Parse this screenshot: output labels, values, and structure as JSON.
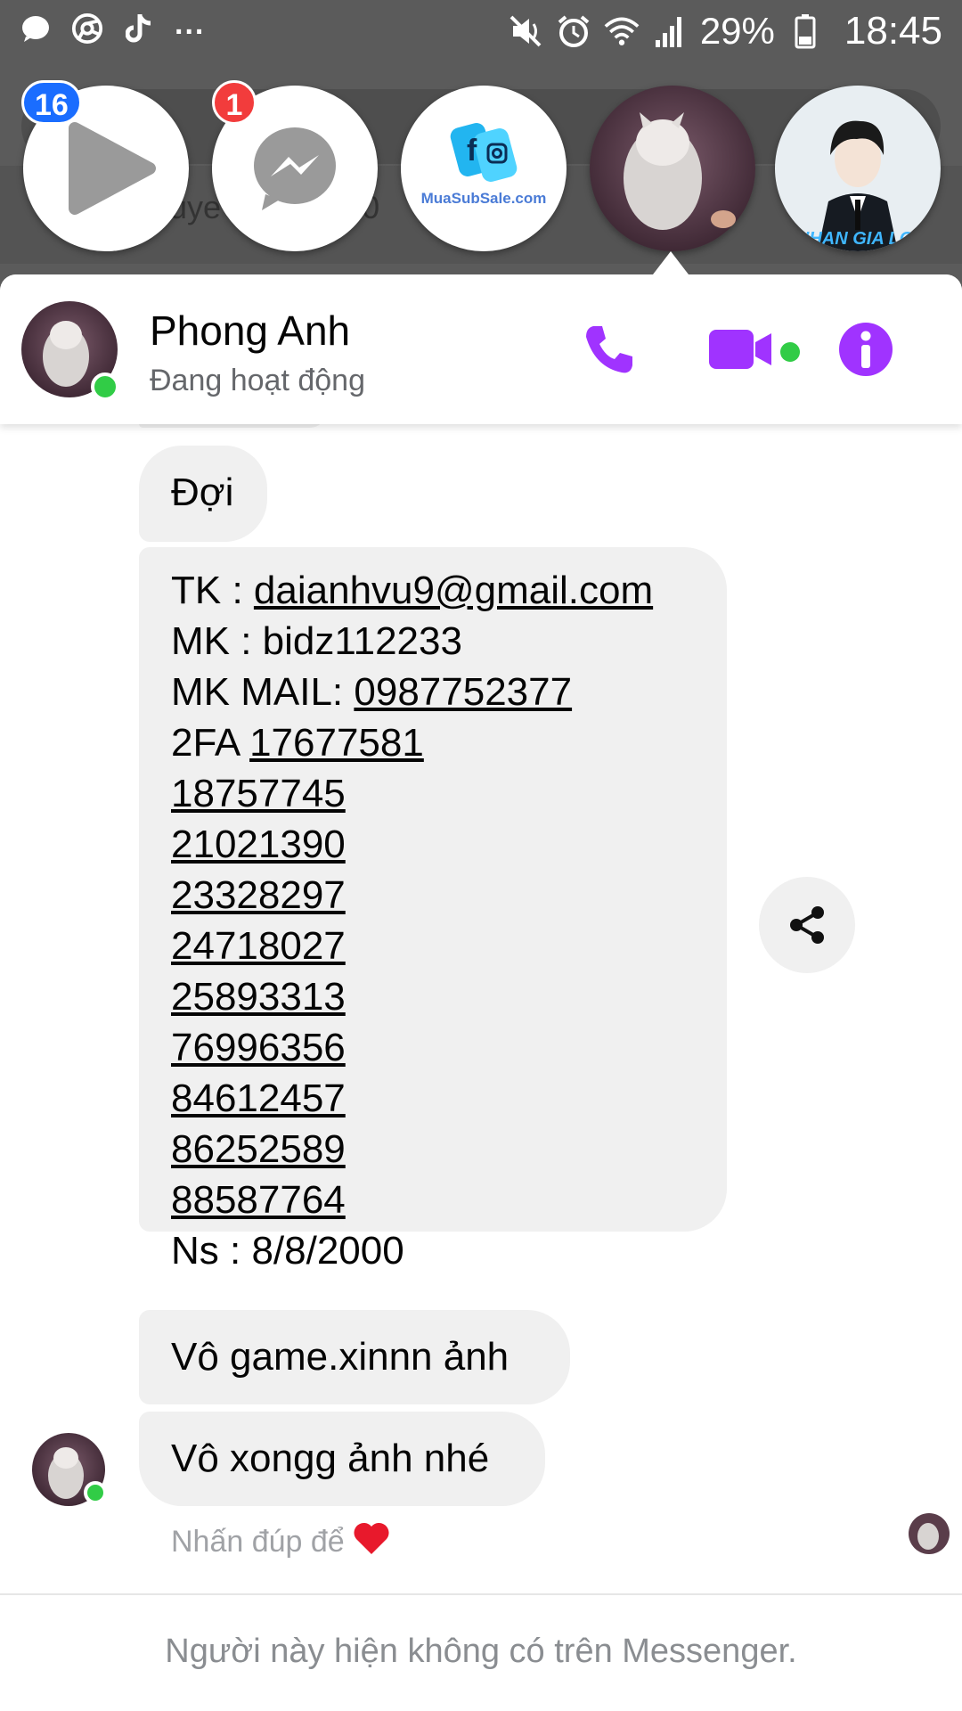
{
  "status_bar": {
    "battery_percent": "29%",
    "time": "18:45",
    "overflow": "...",
    "icons": [
      "chat-bubble-icon",
      "chrome-icon",
      "tiktok-icon",
      "mute-icon",
      "alarm-icon",
      "wifi-icon",
      "signal-icon",
      "battery-icon"
    ]
  },
  "background_page": {
    "row_text": "uye        94   Mac    00"
  },
  "chat_heads": [
    {
      "name": "video-app",
      "badge": "16",
      "badge_color": "#1a6dff"
    },
    {
      "name": "messenger",
      "badge": "1",
      "badge_color": "#f23c3c"
    },
    {
      "name": "muasubsale",
      "logo_text": "MuaSubSale.com"
    },
    {
      "name": "phong-anh-cat",
      "active": true
    },
    {
      "name": "anime-character",
      "caption": "NHAN GIA LỢI"
    }
  ],
  "header": {
    "name": "Phong Anh",
    "status": "Đang hoạt động",
    "accent_color": "#a033ff"
  },
  "messages": {
    "wait": "Đợi",
    "credentials": [
      {
        "prefix": "TK : ",
        "link": "daianhvu9@gmail.com"
      },
      {
        "prefix": "MK : bidz112233",
        "link": ""
      },
      {
        "prefix": "MK MAIL: ",
        "link": "0987752377"
      },
      {
        "prefix": "2FA ",
        "link": "17677581 "
      },
      {
        "prefix": "",
        "link": "18757745"
      },
      {
        "prefix": "",
        "link": "21021390"
      },
      {
        "prefix": "",
        "link": "23328297"
      },
      {
        "prefix": "",
        "link": "24718027"
      },
      {
        "prefix": "",
        "link": "25893313"
      },
      {
        "prefix": "",
        "link": "76996356"
      },
      {
        "prefix": "",
        "link": "84612457"
      },
      {
        "prefix": "",
        "link": "86252589"
      },
      {
        "prefix": "",
        "link": "88587764"
      },
      {
        "prefix": "Ns : 8/8/2000",
        "link": ""
      }
    ],
    "game": "Vô game.xinnn ảnh",
    "done": "Vô xongg ảnh nhé"
  },
  "hint": {
    "text": "Nhấn đúp để",
    "emoji": "❤️"
  },
  "footer_note": "Người này hiện không có trên Messenger."
}
